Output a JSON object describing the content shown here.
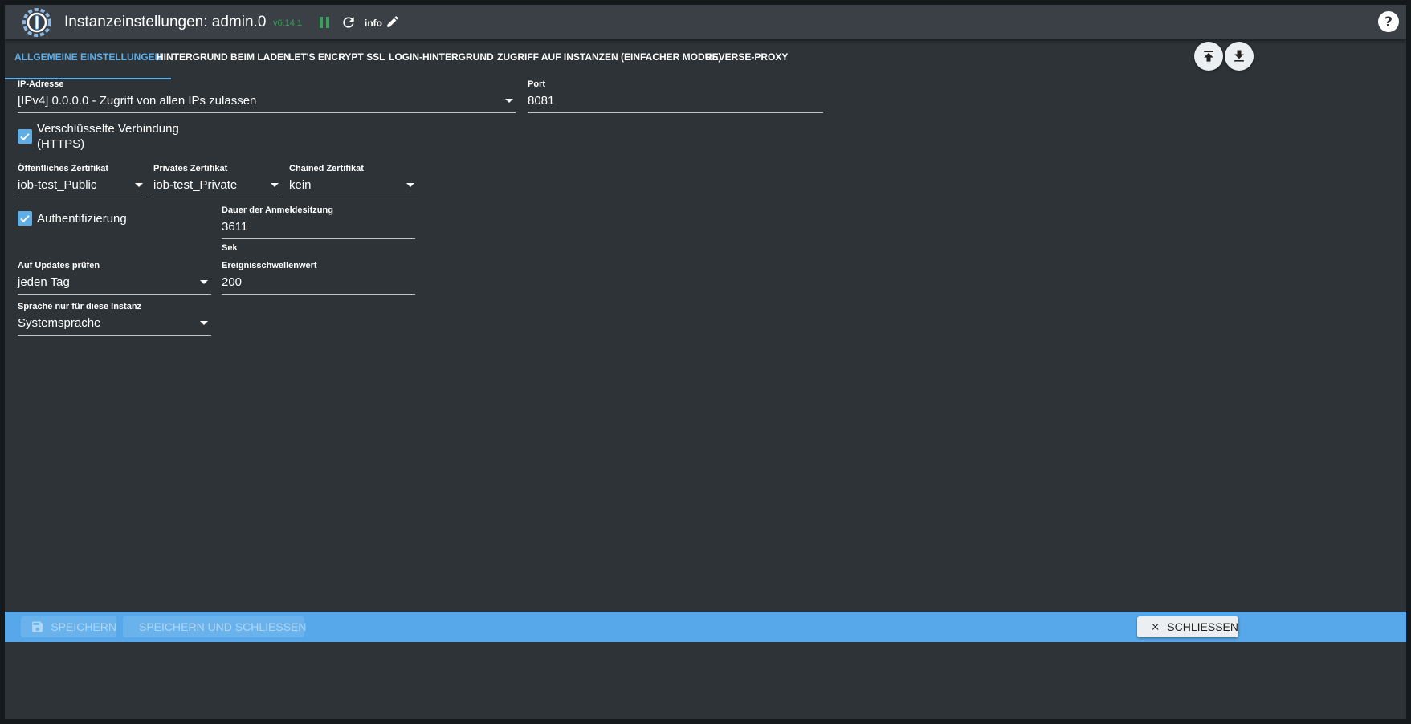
{
  "header": {
    "title": "Instanzeinstellungen: admin.0",
    "version": "v6.14.1",
    "info_label": "info"
  },
  "tabs": [
    {
      "label": "Allgemeine Einstellungen",
      "active": true
    },
    {
      "label": "Hintergrund beim Laden"
    },
    {
      "label": "Let's Encrypt SSL"
    },
    {
      "label": "Login-Hintergrund"
    },
    {
      "label": "Zugriff auf Instanzen (einfacher Modus)"
    },
    {
      "label": "Reverse-Proxy"
    }
  ],
  "form": {
    "ip": {
      "label": "IP-Adresse",
      "value": "[IPv4] 0.0.0.0 - Zugriff von allen IPs zulassen"
    },
    "port": {
      "label": "Port",
      "value": "8081"
    },
    "https": {
      "label_line1": "Verschlüsselte Verbindung",
      "label_line2": "(HTTPS)",
      "checked": true
    },
    "public_cert": {
      "label": "Öffentliches Zertifikat",
      "value": "iob-test_Public"
    },
    "private_cert": {
      "label": "Privates Zertifikat",
      "value": "iob-test_Private"
    },
    "chained_cert": {
      "label": "Chained Zertifikat",
      "value": "kein"
    },
    "auth": {
      "label": "Authentifizierung",
      "checked": true
    },
    "session": {
      "label": "Dauer der Anmeldesitzung",
      "value": "3611",
      "helper": "Sek"
    },
    "updates": {
      "label": "Auf Updates prüfen",
      "value": "jeden Tag"
    },
    "threshold": {
      "label": "Ereignisschwellenwert",
      "value": "200"
    },
    "language": {
      "label": "Sprache nur für diese Instanz",
      "value": "Systemsprache"
    }
  },
  "footer": {
    "save_label": "Speichern",
    "save_close_label": "Speichern und schliessen",
    "close_label": "Schliessen"
  },
  "colors": {
    "accent": "#5faee6",
    "footer": "#56a8ea",
    "background": "#2d3337",
    "header": "#3a4045",
    "checkbox": "#5faee6",
    "status_green": "#3aa05a"
  }
}
